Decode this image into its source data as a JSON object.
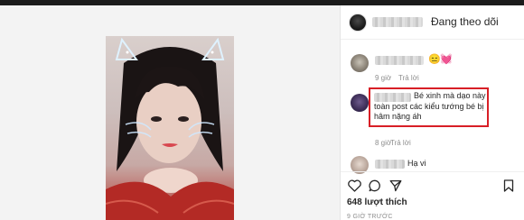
{
  "header": {
    "follow_label": "Đang theo dõi"
  },
  "comments": [
    {
      "time": "9 giờ",
      "reply": "Trả lời",
      "emojis": [
        "😑",
        "💓"
      ]
    },
    {
      "text": "Bé xinh mà dạo này toàn post các kiểu tướng bé bị hâm nặng áh",
      "time": "8 giờ",
      "reply": "Trả lời"
    },
    {
      "text": "Hạ vi"
    }
  ],
  "post": {
    "likes": "648 lượt thích",
    "time": "9 GIỜ TRƯỚC"
  },
  "colors": {
    "highlight_border": "#d81f26",
    "meta_text": "#8e8e8e"
  },
  "icons": [
    "heart-icon",
    "comment-icon",
    "share-icon",
    "bookmark-icon"
  ]
}
